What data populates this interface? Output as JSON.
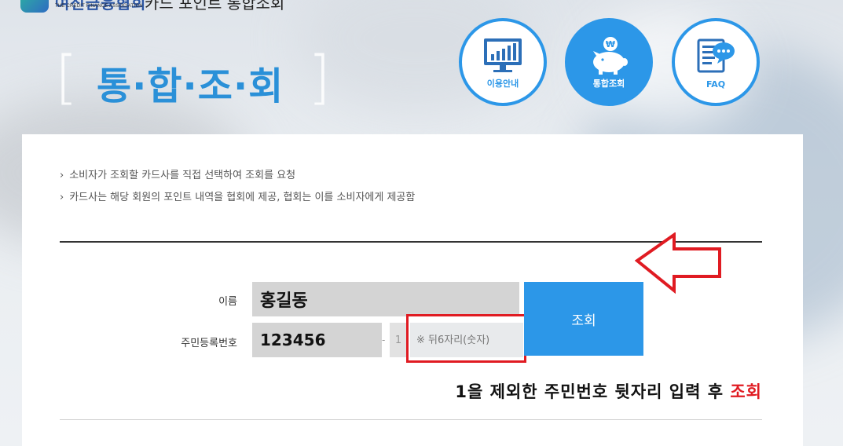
{
  "header": {
    "logo_ko": "여신금융협회",
    "logo_en": "THE CREDIT FINANCE ASSOCIATION",
    "site_title": "카드 포인트 통합조회",
    "page_title": "통·합·조·회",
    "bracket_open": "[",
    "bracket_close": "]"
  },
  "nav": [
    {
      "label": "이용안내",
      "icon": "monitor-chart-icon",
      "active": false
    },
    {
      "label": "통합조회",
      "icon": "piggy-bank-icon",
      "active": true
    },
    {
      "label": "FAQ",
      "icon": "document-chat-icon",
      "active": false
    }
  ],
  "info": {
    "lines": [
      "소비자가 조회할 카드사를 직접 선택하여 조회를 요청",
      "카드사는 해당 회원의 포인트 내역을 협회에 제공, 협회는 이를 소비자에게 제공함"
    ],
    "bullet": "›"
  },
  "form": {
    "name_label": "이름",
    "name_value": "홍길동",
    "rrn_label": "주민등록번호",
    "rrn_front": "123456",
    "rrn_dash": "-",
    "rrn_digit": "1",
    "rrn_back_placeholder": "※ 뒤6자리(숫자)",
    "submit_label": "조회"
  },
  "annotation": {
    "text": "1을 제외한 주민번호 뒷자리 입력 후 ",
    "highlight": "조회"
  },
  "colors": {
    "accent": "#2c97e8",
    "highlight_red": "#e01b22",
    "title_blue": "#2a90d8"
  }
}
